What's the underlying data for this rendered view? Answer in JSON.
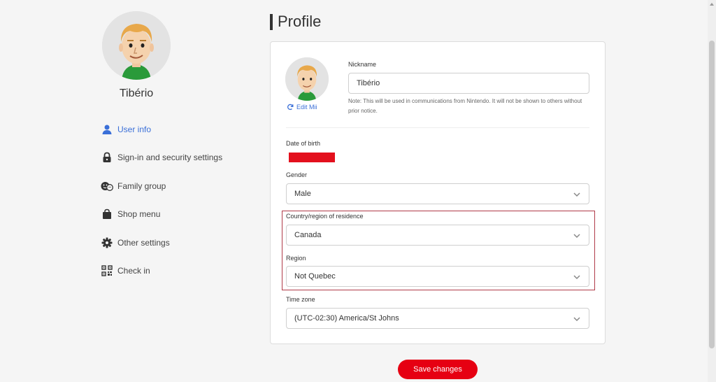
{
  "profile": {
    "username": "Tibério"
  },
  "sidebar": {
    "items": [
      {
        "label": "User info",
        "icon": "user-icon",
        "active": true
      },
      {
        "label": "Sign-in and security settings",
        "icon": "lock-icon",
        "active": false
      },
      {
        "label": "Family group",
        "icon": "family-icon",
        "active": false
      },
      {
        "label": "Shop menu",
        "icon": "shopping-bag-icon",
        "active": false
      },
      {
        "label": "Other settings",
        "icon": "gear-icon",
        "active": false
      },
      {
        "label": "Check in",
        "icon": "qr-code-icon",
        "active": false
      }
    ]
  },
  "header": {
    "title": "Profile"
  },
  "form": {
    "edit_mii_label": "Edit Mii",
    "nickname_label": "Nickname",
    "nickname_value": "Tibério",
    "nickname_note": "Note: This will be used in communications from Nintendo. It will not be shown to others without prior notice.",
    "dob_label": "Date of birth",
    "gender_label": "Gender",
    "gender_value": "Male",
    "country_label": "Country/region of residence",
    "country_value": "Canada",
    "region_label": "Region",
    "region_value": "Not Quebec",
    "timezone_label": "Time zone",
    "timezone_value": "(UTC-02:30) America/St Johns"
  },
  "actions": {
    "save_label": "Save changes"
  },
  "colors": {
    "accent_blue": "#3a6fd8",
    "save_red": "#e60012",
    "redaction_red": "#e3101d",
    "highlight_border": "#b03a48"
  }
}
